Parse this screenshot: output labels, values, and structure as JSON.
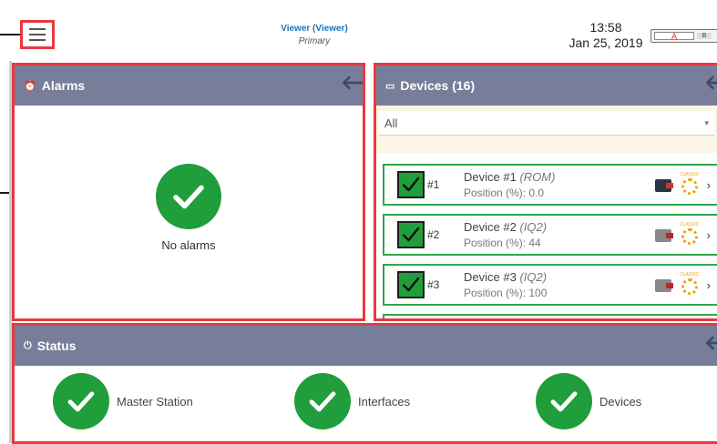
{
  "header": {
    "user_name": "Viewer (Viewer)",
    "user_role": "Primary",
    "time": "13:58",
    "date": "Jan 25, 2019",
    "toggle_a": "A",
    "toggle_b": "B"
  },
  "alarms": {
    "title": "Alarms",
    "empty_text": "No alarms"
  },
  "devices": {
    "title": "Devices (16)",
    "filter_value": "All",
    "items": [
      {
        "number": "#1",
        "name": "Device #1",
        "model": "(ROM)",
        "position": "Position (%): 0.0"
      },
      {
        "number": "#2",
        "name": "Device #2",
        "model": "(IQ2)",
        "position": "Position (%): 44"
      },
      {
        "number": "#3",
        "name": "Device #3",
        "model": "(IQ2)",
        "position": "Position (%): 100"
      }
    ]
  },
  "status": {
    "title": "Status",
    "items": [
      {
        "label": "Master Station"
      },
      {
        "label": "Interfaces"
      },
      {
        "label": "Devices"
      }
    ]
  },
  "colors": {
    "accent_red": "#e63a3f",
    "header_gray": "#787e99",
    "ok_green": "#1f9e3b",
    "link_blue": "#1e73be"
  },
  "icons": {
    "menu": "hamburger-icon",
    "alarm": "alarm-clock-icon",
    "devices": "device-icon",
    "status": "power-icon",
    "back": "back-arrow-icon",
    "ok": "checkmark-icon"
  }
}
